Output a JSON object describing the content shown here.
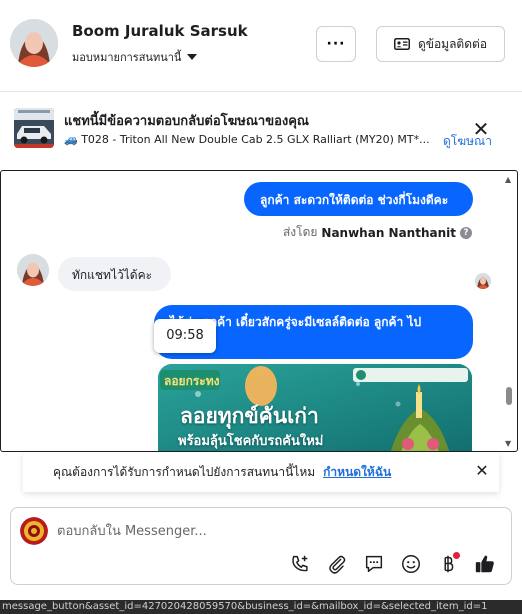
{
  "header": {
    "name": "Boom Juraluk Sarsuk",
    "assign_label": "มอบหมายการสนทนานี้",
    "more_label": "···",
    "contact_label": "ดูข้อมูลติดต่อ"
  },
  "ad_banner": {
    "title": "แชทนี้มีข้อความตอบกลับต่อโฆษณาของคุณ",
    "subtitle": "🚙 T028 - Triton All New Double Cab 2.5 GLX Ralliart (MY20) MT*...",
    "link": "ดูโฆษณา",
    "close": "✕"
  },
  "messages": {
    "msg1": "ลูกค้า สะดวกให้ติดต่อ ช่วงกี่โมงดีคะ",
    "sent_by_prefix": "ส่งโดย",
    "sent_by_name": "Nanwhan Nanthanit",
    "incoming": "ทักแชทไว้ได้คะ",
    "msg2": "ได้ค่ะ ลูกค้า  เดี๋ยวสักครู่จะมีเซลล์ติดต่อ ลูกค้า ไป",
    "tooltip_time": "09:58",
    "promo_text_1": "ลอยทุกข์คันเก่า",
    "promo_text_2": "พร้อมลุ้นโชคกับรถคันใหม่",
    "promo_badge": "ลอยกระทง"
  },
  "notice": {
    "text": "คุณต้องการได้รับการกำหนดไปยังการสนทนานี้ไหม",
    "link": "กำหนดให้ฉัน",
    "close": "✕"
  },
  "composer": {
    "placeholder": "ตอบกลับใน Messenger..."
  },
  "statusbar": {
    "text": "message_button&asset_id=427020428059570&business_id=&mailbox_id=&selected_item_id=1"
  },
  "colors": {
    "accent": "#0866ff",
    "link": "#216fdb",
    "bubble_in": "#f0f2f5",
    "notification_dot": "#e41e3f"
  },
  "icons": [
    "chevron-down-icon",
    "contact-card-icon",
    "close-icon",
    "help-icon",
    "phone-plus-icon",
    "paperclip-icon",
    "chat-bubble-icon",
    "emoji-icon",
    "baht-icon",
    "thumbs-up-icon"
  ]
}
